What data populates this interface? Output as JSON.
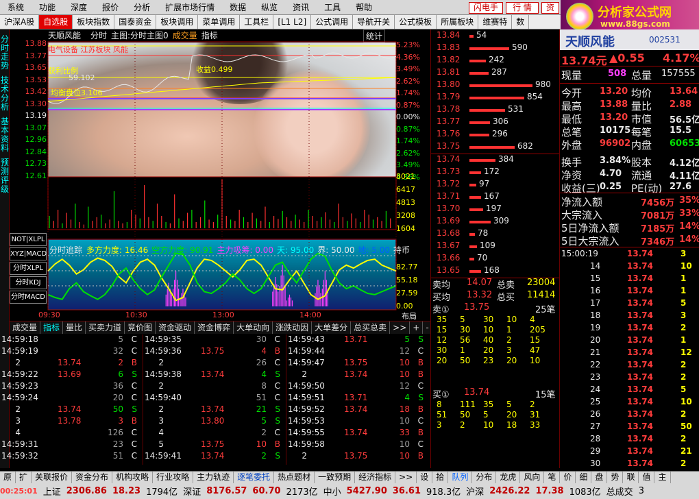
{
  "menubar": {
    "items": [
      "系统",
      "功能",
      "深度",
      "报价",
      "分析",
      "扩展市场行情",
      "数据",
      "纵览",
      "资讯",
      "工具",
      "帮助"
    ],
    "flash_btn": "闪电手",
    "quote_btn": "行 情",
    "info_btn": "资"
  },
  "logo": {
    "title": "分析家公式网",
    "url": "www.88gs.com"
  },
  "tabs": [
    "沪深A股",
    "自选股",
    "板块指数",
    "国泰资金",
    "板块调用",
    "菜单调用",
    "工具栏",
    "[L1 L2]",
    "公式调用",
    "导航开关",
    "公式模板",
    "所属板块",
    "维赛特",
    "数"
  ],
  "left_strip": [
    "分时走势",
    "技术分析",
    "基本资料",
    "预测评级"
  ],
  "chart": {
    "title": "天顺风能",
    "subtitle_items": [
      "分时",
      "主图:分时主图0",
      "成交量",
      "指标"
    ],
    "stat": "统计",
    "price_axis": [
      "13.88",
      "13.77",
      "13.65",
      "13.53",
      "13.42",
      "13.30",
      "13.19",
      "13.07",
      "12.96",
      "12.84",
      "12.73",
      "12.61"
    ],
    "pct_axis": [
      "5.23%",
      "4.36%",
      "3.49%",
      "2.62%",
      "1.74%",
      "0.87%",
      "0.00%",
      "0.87%",
      "1.74%",
      "2.62%",
      "3.49%",
      "4.36%"
    ],
    "vol_axis": [
      "8021",
      "6417",
      "4813",
      "3208",
      "1604"
    ],
    "ind_axis": [
      "82.77",
      "55.18",
      "27.59",
      "0.00"
    ],
    "lab_sector": "电气设备 江苏板块 风能",
    "lab_profit": "获利比例",
    "lab_59": "59.102",
    "lab_jh": "均衡盘位3.106",
    "lab_499": "收益0.499",
    "ind_title": "分时追踪",
    "ind_items": [
      {
        "t": "多方力度: 16.46",
        "c": "#ffff00"
      },
      {
        "t": "空方力度: 90.91",
        "c": "#00e000"
      },
      {
        "t": "主力吸筹: 0.00",
        "c": "#ff40ff"
      },
      {
        "t": "天: 95.00",
        "c": "#00ffff"
      },
      {
        "t": "界: 50.00",
        "c": "#e8e8e8"
      },
      {
        "t": "地: 5.00",
        "c": "#0060ff"
      },
      {
        "t": "持币",
        "c": "#e8e8e8"
      }
    ],
    "time_axis": [
      "09:30",
      "10:30",
      "13:00",
      "14:00"
    ],
    "layout_label": "布局",
    "chips": [
      "NOT|XLPL",
      "XYZ|MACD",
      "分时XLPL",
      "分时KDJ",
      "分时MACD"
    ],
    "ind_series": {
      "yellow": [
        60,
        72,
        80,
        70,
        55,
        62,
        75,
        82,
        78,
        68,
        50,
        40,
        60,
        75,
        80,
        70,
        48,
        30,
        10,
        15,
        40,
        65,
        80,
        78,
        70,
        60,
        50,
        62,
        78,
        80,
        70,
        50,
        30,
        28,
        45,
        60,
        40,
        20,
        12,
        18,
        40,
        62,
        70,
        65,
        72,
        78,
        80,
        70,
        65,
        60
      ],
      "green": [
        20,
        15,
        12,
        30,
        40,
        25,
        18,
        12,
        20,
        35,
        55,
        65,
        45,
        30,
        20,
        28,
        50,
        70,
        90,
        88,
        70,
        40,
        25,
        22,
        30,
        40,
        55,
        45,
        30,
        22,
        30,
        50,
        70,
        75,
        55,
        40,
        60,
        80,
        90,
        85,
        60,
        40,
        30,
        35,
        28,
        22,
        20,
        25,
        30,
        35
      ],
      "magenta": [
        0,
        0,
        0,
        0,
        0,
        0,
        0,
        0,
        0,
        0,
        0,
        0,
        0,
        0,
        0,
        0,
        0,
        40,
        60,
        30,
        0,
        0,
        0,
        0,
        0,
        0,
        0,
        0,
        0,
        0,
        0,
        0,
        50,
        70,
        20,
        0,
        0,
        0,
        45,
        60,
        0,
        0,
        0,
        0,
        0,
        0,
        0,
        0,
        0,
        0
      ]
    },
    "vol_bars": [
      20,
      12,
      30,
      8,
      25,
      14,
      40,
      10,
      6,
      35,
      12,
      18,
      22,
      8,
      14,
      60,
      12,
      8,
      10,
      30,
      22,
      16,
      70,
      18,
      12,
      40,
      20,
      10,
      8,
      55,
      16,
      12,
      25,
      30,
      10,
      18,
      45,
      14,
      10,
      22,
      80,
      20,
      14,
      12,
      30,
      18,
      10,
      25,
      16,
      12,
      35,
      10,
      20,
      15,
      28,
      18,
      12,
      22,
      14,
      10,
      30,
      20,
      12,
      18,
      26,
      14,
      10,
      40,
      18,
      12,
      24,
      16,
      10,
      30,
      22,
      14,
      18,
      12,
      28,
      16
    ]
  },
  "orderbook": {
    "asks": [
      {
        "p": "13.84",
        "v": "54",
        "w": 6
      },
      {
        "p": "13.83",
        "v": "590",
        "w": 58
      },
      {
        "p": "13.82",
        "v": "242",
        "w": 24
      },
      {
        "p": "13.81",
        "v": "287",
        "w": 28
      },
      {
        "p": "13.80",
        "v": "980",
        "w": 92
      },
      {
        "p": "13.79",
        "v": "854",
        "w": 80
      },
      {
        "p": "13.78",
        "v": "531",
        "w": 52
      },
      {
        "p": "13.77",
        "v": "306",
        "w": 30
      },
      {
        "p": "13.76",
        "v": "296",
        "w": 29
      },
      {
        "p": "13.75",
        "v": "682",
        "w": 66
      }
    ],
    "bids": [
      {
        "p": "13.74",
        "v": "384",
        "w": 38
      },
      {
        "p": "13.73",
        "v": "172",
        "w": 17
      },
      {
        "p": "13.72",
        "v": "97",
        "w": 10
      },
      {
        "p": "13.71",
        "v": "167",
        "w": 17
      },
      {
        "p": "13.70",
        "v": "197",
        "w": 20
      },
      {
        "p": "13.69",
        "v": "309",
        "w": 31
      },
      {
        "p": "13.68",
        "v": "78",
        "w": 8
      },
      {
        "p": "13.67",
        "v": "109",
        "w": 11
      },
      {
        "p": "13.66",
        "v": "70",
        "w": 7
      },
      {
        "p": "13.65",
        "v": "168",
        "w": 17
      }
    ],
    "sell_avg_l": "卖均",
    "sell_avg": "14.07",
    "sell_total_l": "总卖",
    "sell_total": "23004",
    "buy_avg_l": "买均",
    "buy_avg": "13.32",
    "buy_total_l": "总买",
    "buy_total": "11414",
    "sell1_l": "卖①",
    "sell1_p": "13.75",
    "sell1_n": "25笔",
    "sell_grid": [
      [
        "35",
        "5",
        "30",
        "10",
        "4"
      ],
      [
        "15",
        "30",
        "10",
        "1",
        "205"
      ],
      [
        "12",
        "56",
        "40",
        "2",
        "15"
      ],
      [
        "30",
        "1",
        "20",
        "3",
        "47"
      ],
      [
        "20",
        "50",
        "23",
        "20",
        "10"
      ]
    ],
    "buy1_l": "买①",
    "buy1_p": "13.74",
    "buy1_n": "15笔",
    "buy_grid": [
      [
        "8",
        "111",
        "35",
        "5",
        "2"
      ],
      [
        "51",
        "50",
        "5",
        "20",
        "31"
      ],
      [
        "3",
        "2",
        "10",
        "18",
        "33"
      ]
    ]
  },
  "quote": {
    "name": "天顺风能",
    "code": "002531",
    "price": "13.74元",
    "change": "▲0.55",
    "pct": "4.17%",
    "now_l": "现量",
    "now": "508",
    "total_l": "总量",
    "total": "157555",
    "rows": [
      {
        "a": "今开",
        "av": "13.20",
        "b": "均价",
        "bv": "13.64",
        "ac": "#ff3c3c",
        "bc": "#ff3c3c"
      },
      {
        "a": "最高",
        "av": "13.88",
        "b": "量比",
        "bv": "2.88",
        "ac": "#ff3c3c",
        "bc": "#ff3c3c"
      },
      {
        "a": "最低",
        "av": "13.20",
        "b": "市值",
        "bv": "56.5亿",
        "ac": "#ff3c3c",
        "bc": "#e8e8e8"
      },
      {
        "a": "总笔",
        "av": "10175",
        "b": "每笔",
        "bv": "15.5",
        "ac": "#e8e8e8",
        "bc": "#e8e8e8"
      },
      {
        "a": "外盘",
        "av": "96902",
        "b": "内盘",
        "bv": "60653",
        "ac": "#ff3c3c",
        "bc": "#00e000"
      },
      {
        "a": "换手",
        "av": "3.84%",
        "b": "股本",
        "bv": "4.12亿",
        "ac": "#e8e8e8",
        "bc": "#e8e8e8"
      },
      {
        "a": "净资",
        "av": "4.70",
        "b": "流通",
        "bv": "4.11亿",
        "ac": "#e8e8e8",
        "bc": "#e8e8e8"
      },
      {
        "a": "收益(三)",
        "av": "0.25",
        "b": "PE(动)",
        "bv": "27.6",
        "ac": "#e8e8e8",
        "bc": "#e8e8e8"
      }
    ],
    "flows": [
      {
        "l": "净流入额",
        "v": "7456万",
        "p": "35%"
      },
      {
        "l": "大宗流入",
        "v": "7081万",
        "p": "33%"
      },
      {
        "l": "5日净流入额",
        "v": "7185万",
        "p": "14%"
      },
      {
        "l": "5日大宗流入",
        "v": "7346万",
        "p": "14%"
      }
    ],
    "minute": [
      {
        "t": "15:00:19",
        "p": "13.74",
        "v": "3"
      },
      {
        "t": "14",
        "p": "13.74",
        "v": "10"
      },
      {
        "t": "15",
        "p": "13.74",
        "v": "1"
      },
      {
        "t": "16",
        "p": "13.74",
        "v": "1"
      },
      {
        "t": "17",
        "p": "13.74",
        "v": "5"
      },
      {
        "t": "18",
        "p": "13.74",
        "v": "3"
      },
      {
        "t": "19",
        "p": "13.74",
        "v": "2"
      },
      {
        "t": "20",
        "p": "13.74",
        "v": "1"
      },
      {
        "t": "21",
        "p": "13.74",
        "v": "12"
      },
      {
        "t": "22",
        "p": "13.74",
        "v": "2"
      },
      {
        "t": "23",
        "p": "13.74",
        "v": "2"
      },
      {
        "t": "24",
        "p": "13.74",
        "v": "5"
      },
      {
        "t": "25",
        "p": "13.74",
        "v": "10"
      },
      {
        "t": "26",
        "p": "13.74",
        "v": "2"
      },
      {
        "t": "27",
        "p": "13.74",
        "v": "50"
      },
      {
        "t": "28",
        "p": "13.74",
        "v": "2"
      },
      {
        "t": "29",
        "p": "13.74",
        "v": "21"
      },
      {
        "t": "30",
        "p": "13.74",
        "v": "2"
      }
    ]
  },
  "tick_tabs": [
    "成交量",
    "指标",
    "量比",
    "买卖力道",
    "竞价图",
    "资金驱动",
    "资金博弈",
    "大单动向",
    "涨跌动因",
    "大单差分",
    "总买总卖",
    ">>",
    "+",
    "-",
    "↓"
  ],
  "ticks": [
    [
      {
        "t": "14:59:18",
        "p": "",
        "v": "5",
        "f": "C"
      },
      {
        "t": "14:59:19",
        "p": "",
        "v": "32",
        "f": "C"
      },
      {
        "t": "2",
        "p": "13.74",
        "v": "2",
        "f": "B"
      },
      {
        "t": "14:59:22",
        "p": "13.69",
        "v": "6",
        "f": "S"
      },
      {
        "t": "14:59:23",
        "p": "",
        "v": "36",
        "f": "C"
      },
      {
        "t": "14:59:24",
        "p": "",
        "v": "20",
        "f": "C"
      },
      {
        "t": "2",
        "p": "13.74",
        "v": "50",
        "f": "S"
      },
      {
        "t": "3",
        "p": "13.78",
        "v": "3",
        "f": "B"
      },
      {
        "t": "4",
        "p": "",
        "v": "126",
        "f": "C"
      },
      {
        "t": "14:59:31",
        "p": "",
        "v": "23",
        "f": "C"
      },
      {
        "t": "14:59:32",
        "p": "",
        "v": "51",
        "f": "C"
      }
    ],
    [
      {
        "t": "14:59:35",
        "p": "",
        "v": "30",
        "f": "C"
      },
      {
        "t": "14:59:36",
        "p": "13.75",
        "v": "4",
        "f": "B"
      },
      {
        "t": "2",
        "p": "",
        "v": "26",
        "f": "C"
      },
      {
        "t": "14:59:38",
        "p": "13.74",
        "v": "4",
        "f": "S"
      },
      {
        "t": "2",
        "p": "",
        "v": "8",
        "f": "C"
      },
      {
        "t": "14:59:40",
        "p": "",
        "v": "51",
        "f": "C"
      },
      {
        "t": "2",
        "p": "13.74",
        "v": "21",
        "f": "S"
      },
      {
        "t": "3",
        "p": "13.80",
        "v": "5",
        "f": "S"
      },
      {
        "t": "4",
        "p": "",
        "v": "2",
        "f": "C"
      },
      {
        "t": "5",
        "p": "13.75",
        "v": "10",
        "f": "B"
      },
      {
        "t": "14:59:41",
        "p": "13.74",
        "v": "2",
        "f": "S"
      }
    ],
    [
      {
        "t": "14:59:43",
        "p": "13.71",
        "v": "5",
        "f": "S"
      },
      {
        "t": "14:59:44",
        "p": "",
        "v": "12",
        "f": "C"
      },
      {
        "t": "14:59:47",
        "p": "13.75",
        "v": "10",
        "f": "B"
      },
      {
        "t": "2",
        "p": "13.74",
        "v": "10",
        "f": "B"
      },
      {
        "t": "14:59:50",
        "p": "",
        "v": "12",
        "f": "C"
      },
      {
        "t": "14:59:51",
        "p": "13.71",
        "v": "4",
        "f": "S"
      },
      {
        "t": "14:59:52",
        "p": "13.74",
        "v": "18",
        "f": "B"
      },
      {
        "t": "14:59:53",
        "p": "",
        "v": "10",
        "f": "C"
      },
      {
        "t": "14:59:55",
        "p": "13.74",
        "v": "33",
        "f": "B"
      },
      {
        "t": "14:59:58",
        "p": "",
        "v": "10",
        "f": "C"
      },
      {
        "t": "2",
        "p": "13.75",
        "v": "10",
        "f": "B"
      }
    ]
  ],
  "bottom_tabs": [
    "原",
    "扩",
    "关联报价",
    "资金分布",
    "机构攻略",
    "行业攻略",
    "主力轨迹",
    "逐笔委托",
    "热点题材",
    "一致预期",
    "经济指标",
    ">>",
    "设",
    "拾",
    "队列",
    "分布",
    "龙虎",
    "风向",
    "笔",
    "价",
    "细",
    "盘",
    "势",
    "联",
    "值",
    "主"
  ],
  "status": {
    "time": "00:25:01",
    "sh_l": "上证",
    "sh": "2306.86",
    "sh_c": "18.23",
    "sh_v": "1794亿",
    "sz_l": "深证",
    "sz": "8176.57",
    "sz_c": "60.70",
    "sz_v": "2173亿",
    "zx_l": "中小",
    "zx": "5427.90",
    "zx_c": "36.61",
    "zx_v": "918.3亿",
    "hs_l": "沪深",
    "hs": "2426.22",
    "hs_c": "17.38",
    "hs_v": "1083亿",
    "tail": "总成交",
    "tail_n": "3"
  },
  "colors": {
    "red": "#ff3c3c",
    "green": "#00e000",
    "white": "#e8e8e8"
  }
}
